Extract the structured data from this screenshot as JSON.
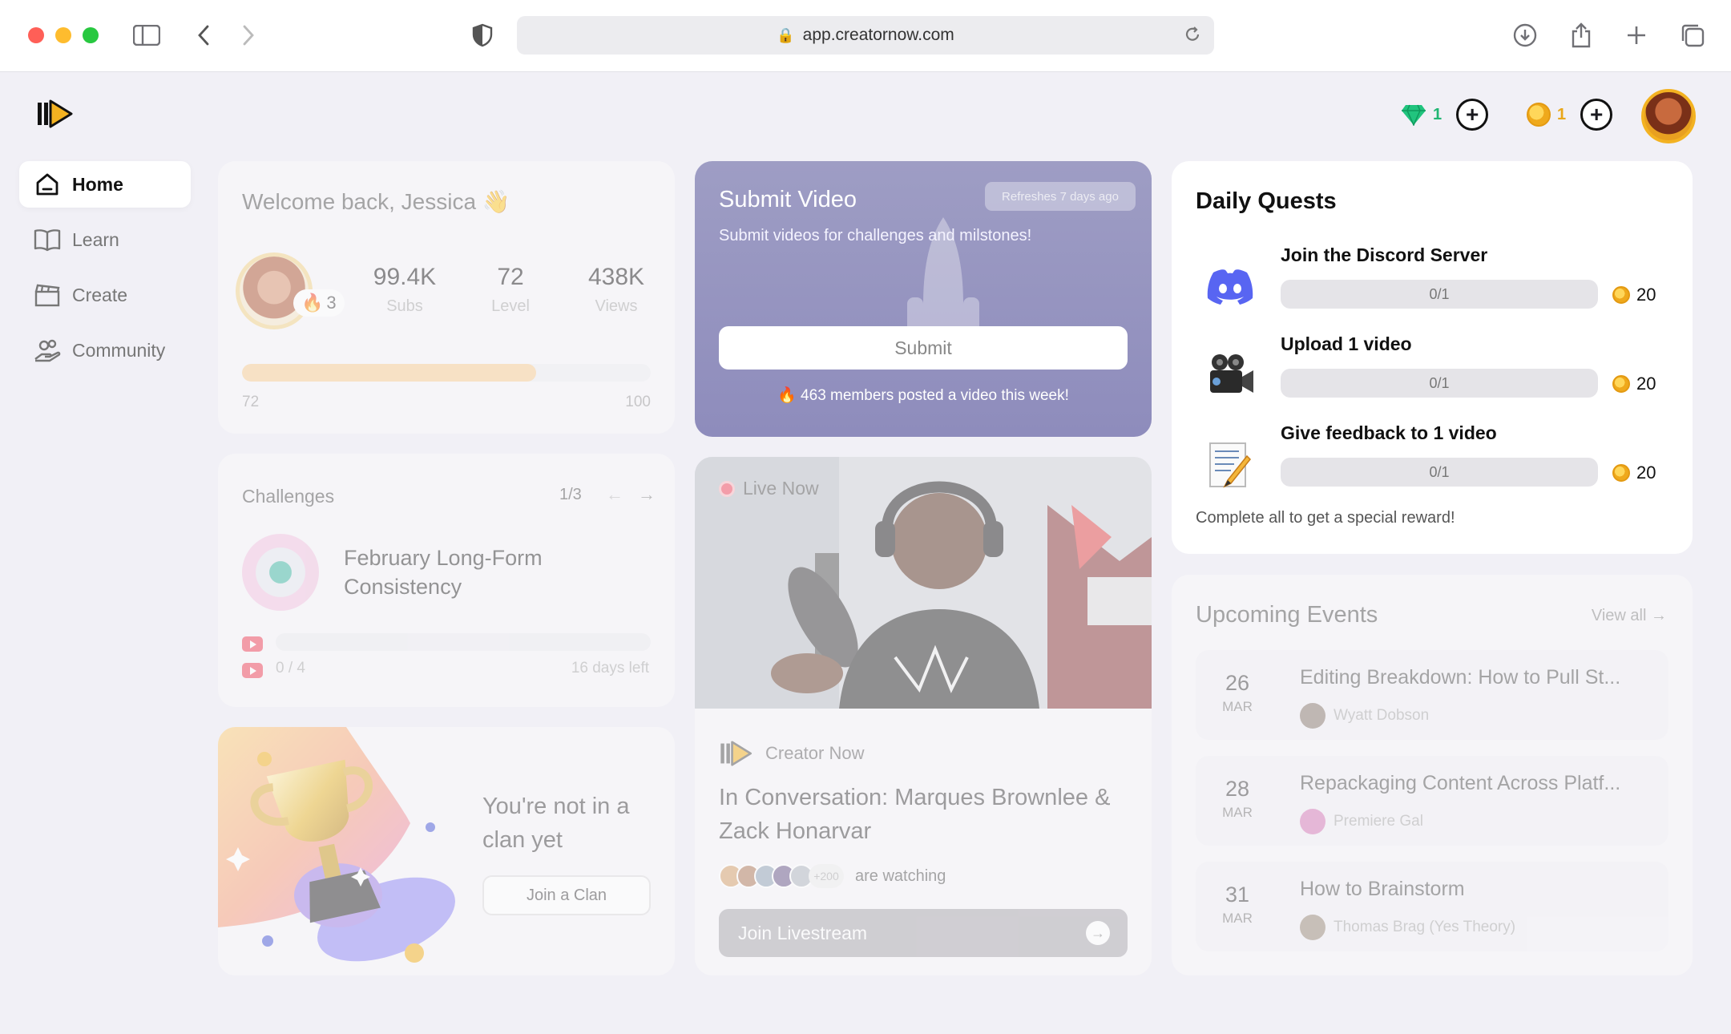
{
  "browser": {
    "url": "app.creatornow.com"
  },
  "header": {
    "gems": "1",
    "coins": "1"
  },
  "sidebar": {
    "items": [
      {
        "label": "Home"
      },
      {
        "label": "Learn"
      },
      {
        "label": "Create"
      },
      {
        "label": "Community"
      }
    ]
  },
  "welcome": {
    "title": "Welcome back, Jessica",
    "emoji": "👋",
    "streak": "3",
    "stats": [
      {
        "value": "99.4K",
        "label": "Subs"
      },
      {
        "value": "72",
        "label": "Level"
      },
      {
        "value": "438K",
        "label": "Views"
      }
    ],
    "level_progress": 0.72,
    "level_min": "72",
    "level_max": "100"
  },
  "challenges": {
    "title": "Challenges",
    "page": "1/3",
    "name": "February Long-Form Consistency",
    "progress_text": "0 / 4",
    "days_left": "16 days left"
  },
  "clan": {
    "text": "You're not in a clan yet",
    "button": "Join a Clan"
  },
  "submit_video": {
    "title": "Submit Video",
    "subtitle": "Submit videos for challenges and milstones!",
    "badge": "Refreshes 7 days ago",
    "button": "Submit",
    "note": "🔥 463 members posted a video this week!"
  },
  "live": {
    "badge": "Live Now",
    "brand": "Creator Now",
    "title": "In Conversation: Marques Brownlee & Zack Honarvar",
    "watch_more": "+200",
    "watching": "are watching",
    "button": "Join Livestream"
  },
  "daily_quests": {
    "title": "Daily Quests",
    "quests": [
      {
        "name": "Join the Discord Server",
        "progress": "0/1",
        "reward": "20",
        "icon": "discord-icon"
      },
      {
        "name": "Upload 1 video",
        "progress": "0/1",
        "reward": "20",
        "icon": "movie-camera-icon"
      },
      {
        "name": "Give feedback to 1 video",
        "progress": "0/1",
        "reward": "20",
        "icon": "memo-icon"
      }
    ],
    "footer": "Complete all to get a special reward!"
  },
  "events": {
    "title": "Upcoming Events",
    "view_all": "View all",
    "items": [
      {
        "day": "26",
        "month": "MAR",
        "title": "Editing Breakdown: How to Pull St...",
        "host": "Wyatt Dobson"
      },
      {
        "day": "28",
        "month": "MAR",
        "title": "Repackaging Content Across Platf...",
        "host": "Premiere Gal"
      },
      {
        "day": "31",
        "month": "MAR",
        "title": "How to Brainstorm",
        "host": "Thomas Brag (Yes Theory)"
      }
    ]
  },
  "colors": {
    "accent": "#f3b221",
    "gem": "#21b673",
    "coin": "#e9a71a",
    "submit_card": "#9e9dc4",
    "live_dot": "#f1485d"
  }
}
